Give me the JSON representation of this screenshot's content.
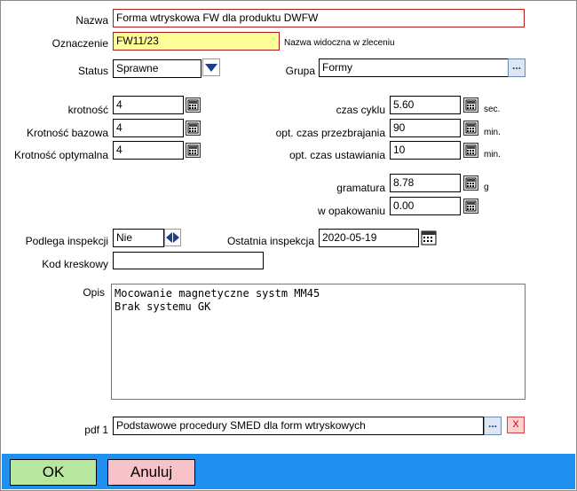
{
  "form": {
    "nazwa": {
      "label": "Nazwa",
      "value": "Forma wtryskowa FW dla produktu DWFW"
    },
    "oznaczenie": {
      "label": "Oznaczenie",
      "value": "FW11/23",
      "hint": "Nazwa widoczna w zleceniu"
    },
    "status": {
      "label": "Status",
      "value": "Sprawne"
    },
    "grupa": {
      "label": "Grupa",
      "value": "Formy"
    },
    "krotnosc": {
      "label": "krotność",
      "value": "4"
    },
    "krotnosc_bazowa": {
      "label": "Krotność bazowa",
      "value": "4"
    },
    "krotnosc_optymalna": {
      "label": "Krotność optymalna",
      "value": "4"
    },
    "czas_cyklu": {
      "label": "czas cyklu",
      "value": "5.60",
      "unit": "sec."
    },
    "opt_czas_przezbrajania": {
      "label": "opt. czas przezbrajania",
      "value": "90",
      "unit": "min."
    },
    "opt_czas_ustawiania": {
      "label": "opt. czas ustawiania",
      "value": "10",
      "unit": "min."
    },
    "gramatura": {
      "label": "gramatura",
      "value": "8.78",
      "unit": "g"
    },
    "w_opakowaniu": {
      "label": "w opakowaniu",
      "value": "0.00"
    },
    "podlega_inspekcji": {
      "label": "Podlega inspekcji",
      "value": "Nie"
    },
    "ostatnia_inspekcja": {
      "label": "Ostatnia inspekcja",
      "value": "2020-05-19"
    },
    "kod_kreskowy": {
      "label": "Kod kreskowy",
      "value": ""
    },
    "opis": {
      "label": "Opis",
      "value": "Mocowanie magnetyczne systm MM45\nBrak systemu GK"
    },
    "pdf1": {
      "label": "pdf 1",
      "value": "Podstawowe procedury SMED dla form wtryskowych"
    },
    "browse_label": "...",
    "clear_label": "X"
  },
  "buttons": {
    "ok": "OK",
    "cancel": "Anuluj"
  },
  "colors": {
    "bottom_bar": "#1f8ff0",
    "ok_button": "#b8e8a0",
    "cancel_button": "#f7c3c8",
    "highlight_field": "#ffff99",
    "required_border": "#b01c1c"
  },
  "icons": [
    "calculator-icon",
    "chevron-down-icon",
    "spinner-arrows-icon",
    "calendar-icon"
  ]
}
